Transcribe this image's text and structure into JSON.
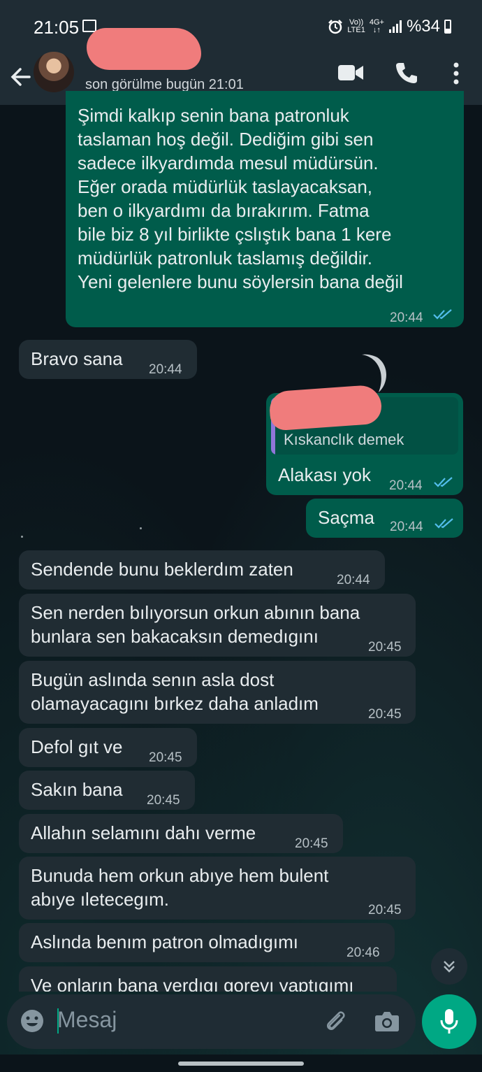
{
  "status_bar": {
    "time": "21:05",
    "network_top": "Vo))",
    "network_bottom": "LTE1",
    "net_type_top": "4G+",
    "net_type_bottom": "↓↑",
    "battery": "%34"
  },
  "header": {
    "last_seen": "son görülme bugün 21:01"
  },
  "messages": [
    {
      "dir": "out",
      "text": "Şimdi kalkıp senin bana patronluk\ntaslaman hoş değil. Dediğim gibi sen\nsadece ilkyardımda mesul müdürsün.\nEğer orada müdürlük taslayacaksan,\nben o ilkyardımı da bırakırım. Fatma\nbile biz 8 yıl birlikte çslıştık bana 1 kere\nmüdürlük patronluk taslamış değildir.\nYeni gelenlere bunu söylersin bana değil",
      "time": "20:44",
      "status": "read"
    },
    {
      "dir": "in",
      "text": "Bravo sana",
      "time": "20:44"
    },
    {
      "dir": "out",
      "quote_name": "...:!",
      "quote_text": "Kıskanclık demek",
      "text": "Alakası yok",
      "time": "20:44",
      "status": "read"
    },
    {
      "dir": "out",
      "text": "Saçma",
      "time": "20:44",
      "status": "read"
    },
    {
      "dir": "in",
      "text": "Sendende bunu beklerdım zaten",
      "time": "20:44"
    },
    {
      "dir": "in",
      "text": "Sen nerden bılıyorsun orkun abının bana\nbunlara sen bakacaksın demedıgını",
      "time": "20:45"
    },
    {
      "dir": "in",
      "text": "Bugün aslında senın asla dost\nolamayacagını bırkez daha anladım",
      "time": "20:45"
    },
    {
      "dir": "in",
      "text": "Defol gıt ve",
      "time": "20:45"
    },
    {
      "dir": "in",
      "text": "Sakın bana",
      "time": "20:45"
    },
    {
      "dir": "in",
      "text": "Allahın selamını dahı verme",
      "time": "20:45"
    },
    {
      "dir": "in",
      "text": "Bunuda hem orkun abıye hem bulent\nabıye ıletecegım.",
      "time": "20:45"
    },
    {
      "dir": "in",
      "text": "Aslında benım patron olmadıgımı",
      "time": "20:46"
    },
    {
      "dir": "in",
      "text": "Ve onların bana verdıgı gorevı yaptıgımı",
      "time": ""
    }
  ],
  "input": {
    "placeholder": "Mesaj"
  },
  "icons": {
    "back": "arrow-left-icon",
    "video": "video-camera-icon",
    "call": "phone-icon",
    "menu": "more-vertical-icon",
    "emoji": "emoji-icon",
    "attach": "paperclip-icon",
    "camera": "camera-icon",
    "mic": "microphone-icon",
    "scroll": "chevron-double-down-icon"
  },
  "colors": {
    "incoming": "#202c33",
    "outgoing": "#005c4b",
    "accent": "#00a884",
    "read_ticks": "#53bdeb",
    "background": "#0b141a"
  }
}
